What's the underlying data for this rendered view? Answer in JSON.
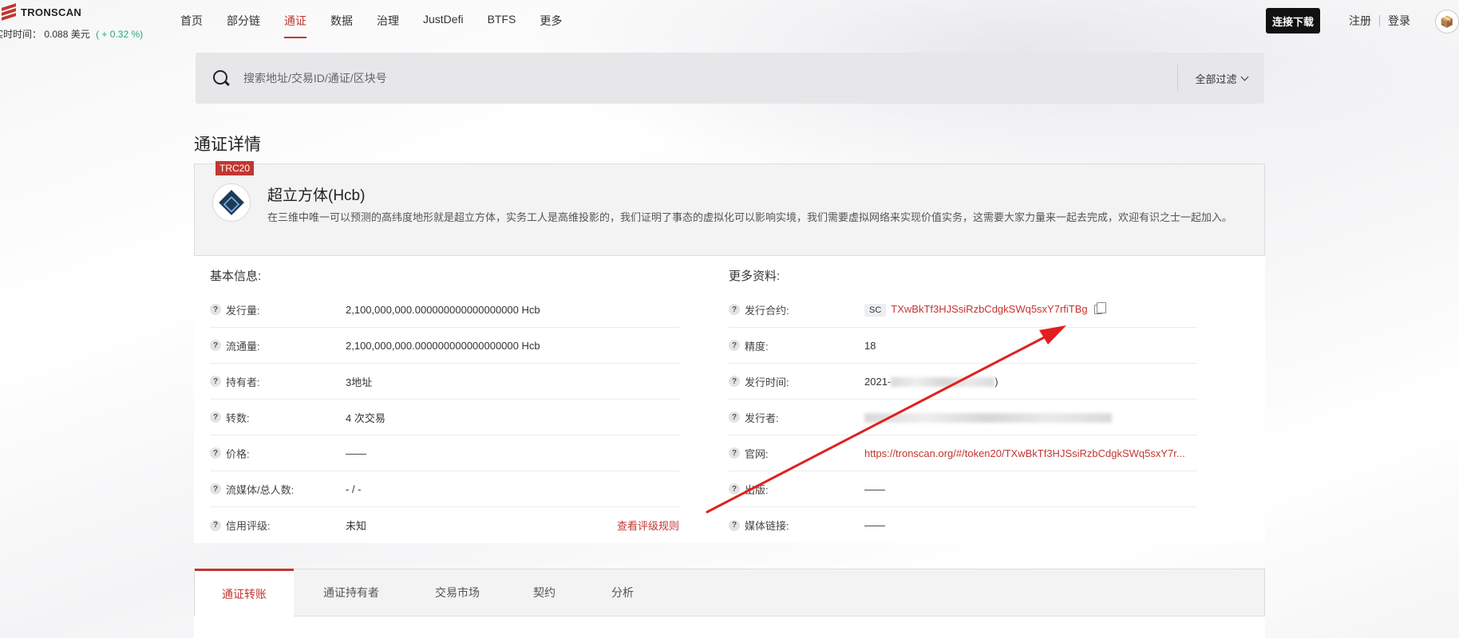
{
  "brand": {
    "name": "TRONSCAN"
  },
  "ticker": {
    "label": "实时时间：",
    "price": "0.088",
    "currency": "美元",
    "change": "( + 0.32 %)"
  },
  "nav": {
    "items": [
      "首页",
      "部分链",
      "通证",
      "数据",
      "治理",
      "JustDefi",
      "BTFS",
      "更多"
    ],
    "active_index": 2
  },
  "header": {
    "download_label": "连接下载",
    "register_label": "注册",
    "login_label": "登录",
    "avatar_icon": "cube-icon"
  },
  "search": {
    "placeholder": "搜索地址/交易ID/通证/区块号",
    "filter_label": "全部过滤"
  },
  "page": {
    "title": "通证详情"
  },
  "token": {
    "standard": "TRC20",
    "name": "超立方体(Hcb)",
    "description": "在三维中唯一可以预测的高纬度地形就是超立方体，实务工人是高维投影的，我们证明了事态的虚拟化可以影响实境，我们需要虚拟网络来实现价值实务，这需要大家力量来一起去完成，欢迎有识之士一起加入。"
  },
  "basic_info": {
    "title": "基本信息:",
    "rows": [
      {
        "label": "发行量:",
        "value": "2,100,000,000.000000000000000000  Hcb"
      },
      {
        "label": "流通量:",
        "value": "2,100,000,000.000000000000000000  Hcb"
      },
      {
        "label": "持有者:",
        "value": "3地址"
      },
      {
        "label": "转数:",
        "value": "4 次交易"
      },
      {
        "label": "价格:",
        "value": "——"
      },
      {
        "label": "流媒体/总人数:",
        "value": "- / -"
      },
      {
        "label": "信用评级:",
        "value": "未知",
        "link": "查看评级规则"
      }
    ]
  },
  "more_info": {
    "title": "更多资料:",
    "contract": {
      "label": "发行合约:",
      "tag": "SC",
      "value": "TXwBkTf3HJSsiRzbCdgkSWq5sxY7rfiTBg"
    },
    "decimals": {
      "label": "精度:",
      "value": "18"
    },
    "issue_time": {
      "label": "发行时间:",
      "value_prefix": "2021-",
      "value_suffix": ")"
    },
    "issuer": {
      "label": "发行者:"
    },
    "website": {
      "label": "官网:",
      "value": "https://tronscan.org/#/token20/TXwBkTf3HJSsiRzbCdgkSWq5sxY7r..."
    },
    "whitepaper": {
      "label": "出版:",
      "value": "——"
    },
    "social": {
      "label": "媒体链接:",
      "value": "——"
    }
  },
  "tabs": [
    "通证转账",
    "通证持有者",
    "交易市场",
    "契约",
    "分析"
  ],
  "annotation": {
    "arrow_color": "#e02020"
  }
}
